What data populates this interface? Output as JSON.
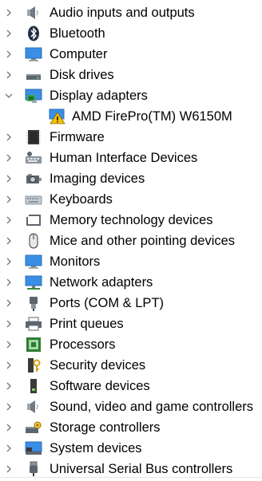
{
  "tree": {
    "items": [
      {
        "label": "Audio inputs and outputs",
        "icon": "speaker-icon",
        "expanded": false
      },
      {
        "label": "Bluetooth",
        "icon": "bluetooth-icon",
        "expanded": false
      },
      {
        "label": "Computer",
        "icon": "computer-monitor-icon",
        "expanded": false
      },
      {
        "label": "Disk drives",
        "icon": "disk-drive-icon",
        "expanded": false
      },
      {
        "label": "Display adapters",
        "icon": "display-adapter-icon",
        "expanded": true
      },
      {
        "label": "AMD FirePro(TM) W6150M",
        "icon": "warning-icon",
        "child": true
      },
      {
        "label": "Firmware",
        "icon": "firmware-chip-icon",
        "expanded": false
      },
      {
        "label": "Human Interface Devices",
        "icon": "hid-keyboard-icon",
        "expanded": false
      },
      {
        "label": "Imaging devices",
        "icon": "camera-icon",
        "expanded": false
      },
      {
        "label": "Keyboards",
        "icon": "keyboard-icon",
        "expanded": false
      },
      {
        "label": "Memory technology devices",
        "icon": "memory-card-icon",
        "expanded": false
      },
      {
        "label": "Mice and other pointing devices",
        "icon": "mouse-icon",
        "expanded": false
      },
      {
        "label": "Monitors",
        "icon": "monitor-icon",
        "expanded": false
      },
      {
        "label": "Network adapters",
        "icon": "network-adapter-icon",
        "expanded": false
      },
      {
        "label": "Ports (COM & LPT)",
        "icon": "port-plug-icon",
        "expanded": false
      },
      {
        "label": "Print queues",
        "icon": "printer-icon",
        "expanded": false
      },
      {
        "label": "Processors",
        "icon": "processor-chip-icon",
        "expanded": false
      },
      {
        "label": "Security devices",
        "icon": "security-key-icon",
        "expanded": false
      },
      {
        "label": "Software devices",
        "icon": "software-device-icon",
        "expanded": false
      },
      {
        "label": "Sound, video and game controllers",
        "icon": "speaker-icon",
        "expanded": false
      },
      {
        "label": "Storage controllers",
        "icon": "storage-controller-icon",
        "expanded": false
      },
      {
        "label": "System devices",
        "icon": "system-devices-icon",
        "expanded": false
      },
      {
        "label": "Universal Serial Bus controllers",
        "icon": "usb-plug-icon",
        "expanded": false
      }
    ]
  },
  "colors": {
    "chevron": "#7a7a7a",
    "monitor_blue": "#3a8ee6",
    "warning_yellow": "#f2c200"
  }
}
